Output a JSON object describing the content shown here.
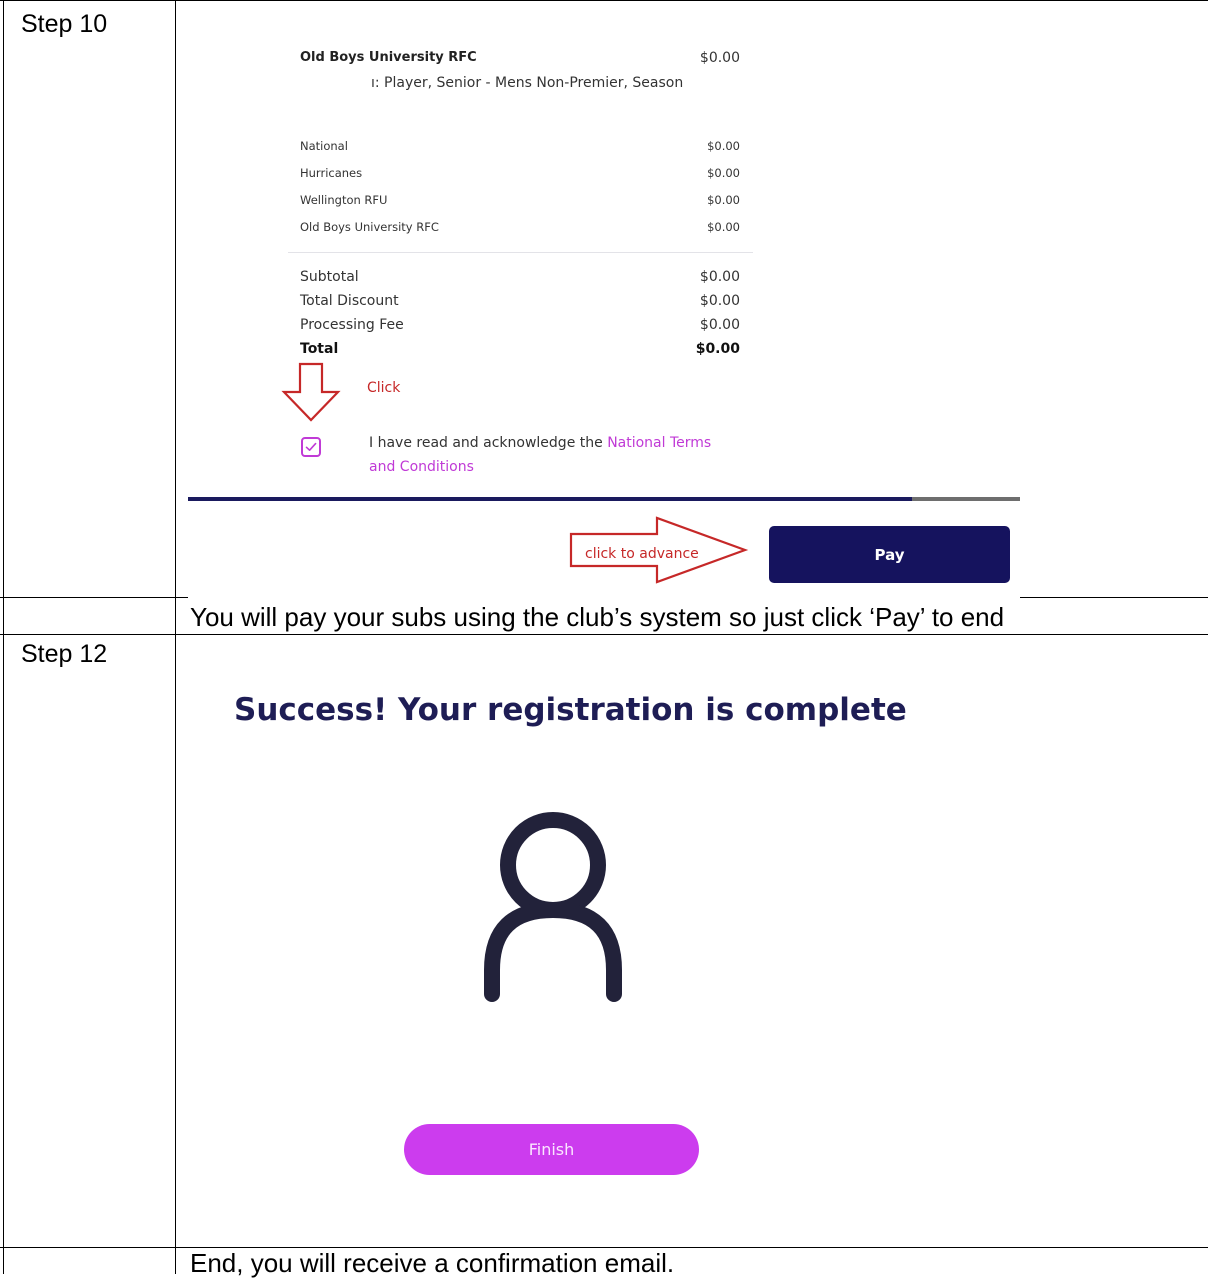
{
  "step10": {
    "label": "Step 10",
    "item": {
      "name": "Old Boys University RFC",
      "price": "$0.00",
      "description": "ı: Player, Senior - Mens Non-Premier, Season"
    },
    "fees": [
      {
        "name": "National",
        "amount": "$0.00"
      },
      {
        "name": "Hurricanes",
        "amount": "$0.00"
      },
      {
        "name": "Wellington RFU",
        "amount": "$0.00"
      },
      {
        "name": "Old Boys University RFC",
        "amount": "$0.00"
      }
    ],
    "summary": [
      {
        "name": "Subtotal",
        "amount": "$0.00"
      },
      {
        "name": "Total Discount",
        "amount": "$0.00"
      },
      {
        "name": "Processing Fee",
        "amount": "$0.00"
      },
      {
        "name": "Total",
        "amount": "$0.00"
      }
    ],
    "annotation_click": "Click",
    "acknowledge_text": "I have read and acknowledge the ",
    "terms_link": "National Terms and Conditions",
    "terms_checked": true,
    "annotation_advance": "click to advance",
    "pay_label": "Pay",
    "caption": "You will pay your subs using the club’s system so just click ‘Pay’ to end"
  },
  "step12": {
    "label": "Step 12",
    "title": "Success! Your registration is complete",
    "icon": "user-icon",
    "finish_label": "Finish",
    "caption": "End, you will receive a confirmation email."
  },
  "colors": {
    "navy": "#15135e",
    "magenta": "#c03ad6",
    "annotation_red": "#c62828"
  }
}
